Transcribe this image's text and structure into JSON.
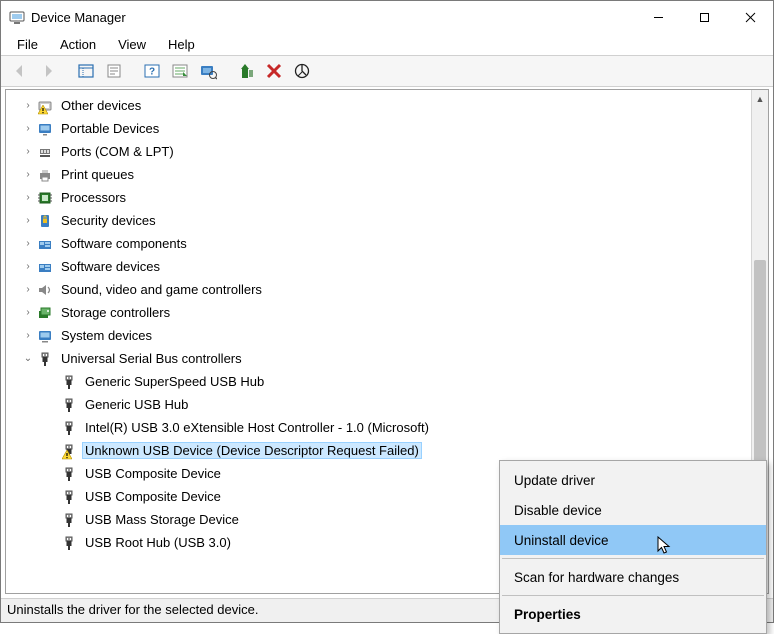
{
  "window": {
    "title": "Device Manager"
  },
  "menu": {
    "items": [
      "File",
      "Action",
      "View",
      "Help"
    ]
  },
  "tree": {
    "categories": [
      {
        "icon": "other-devices",
        "label": "Other devices",
        "badge": "warn"
      },
      {
        "icon": "portable-devices",
        "label": "Portable Devices"
      },
      {
        "icon": "port",
        "label": "Ports (COM & LPT)"
      },
      {
        "icon": "printer",
        "label": "Print queues"
      },
      {
        "icon": "cpu",
        "label": "Processors"
      },
      {
        "icon": "security",
        "label": "Security devices"
      },
      {
        "icon": "software",
        "label": "Software components"
      },
      {
        "icon": "software-dev",
        "label": "Software devices"
      },
      {
        "icon": "sound",
        "label": "Sound, video and game controllers"
      },
      {
        "icon": "storage",
        "label": "Storage controllers"
      },
      {
        "icon": "system",
        "label": "System devices"
      }
    ],
    "usb_category": {
      "label": "Universal Serial Bus controllers",
      "expanded": true,
      "children": [
        {
          "label": "Generic SuperSpeed USB Hub",
          "warn": false
        },
        {
          "label": "Generic USB Hub",
          "warn": false
        },
        {
          "label": "Intel(R) USB 3.0 eXtensible Host Controller - 1.0 (Microsoft)",
          "warn": false
        },
        {
          "label": "Unknown USB Device (Device Descriptor Request Failed)",
          "warn": true,
          "selected": true
        },
        {
          "label": "USB Composite Device",
          "warn": false
        },
        {
          "label": "USB Composite Device",
          "warn": false
        },
        {
          "label": "USB Mass Storage Device",
          "warn": false
        },
        {
          "label": "USB Root Hub (USB 3.0)",
          "warn": false
        }
      ]
    }
  },
  "context_menu": {
    "items": [
      {
        "label": "Update driver"
      },
      {
        "label": "Disable device"
      },
      {
        "label": "Uninstall device",
        "hover": true
      },
      {
        "label": "Scan for hardware changes",
        "sep_before": true
      },
      {
        "label": "Properties",
        "bold": true,
        "sep_before": true
      }
    ]
  },
  "status": {
    "text": "Uninstalls the driver for the selected device."
  }
}
